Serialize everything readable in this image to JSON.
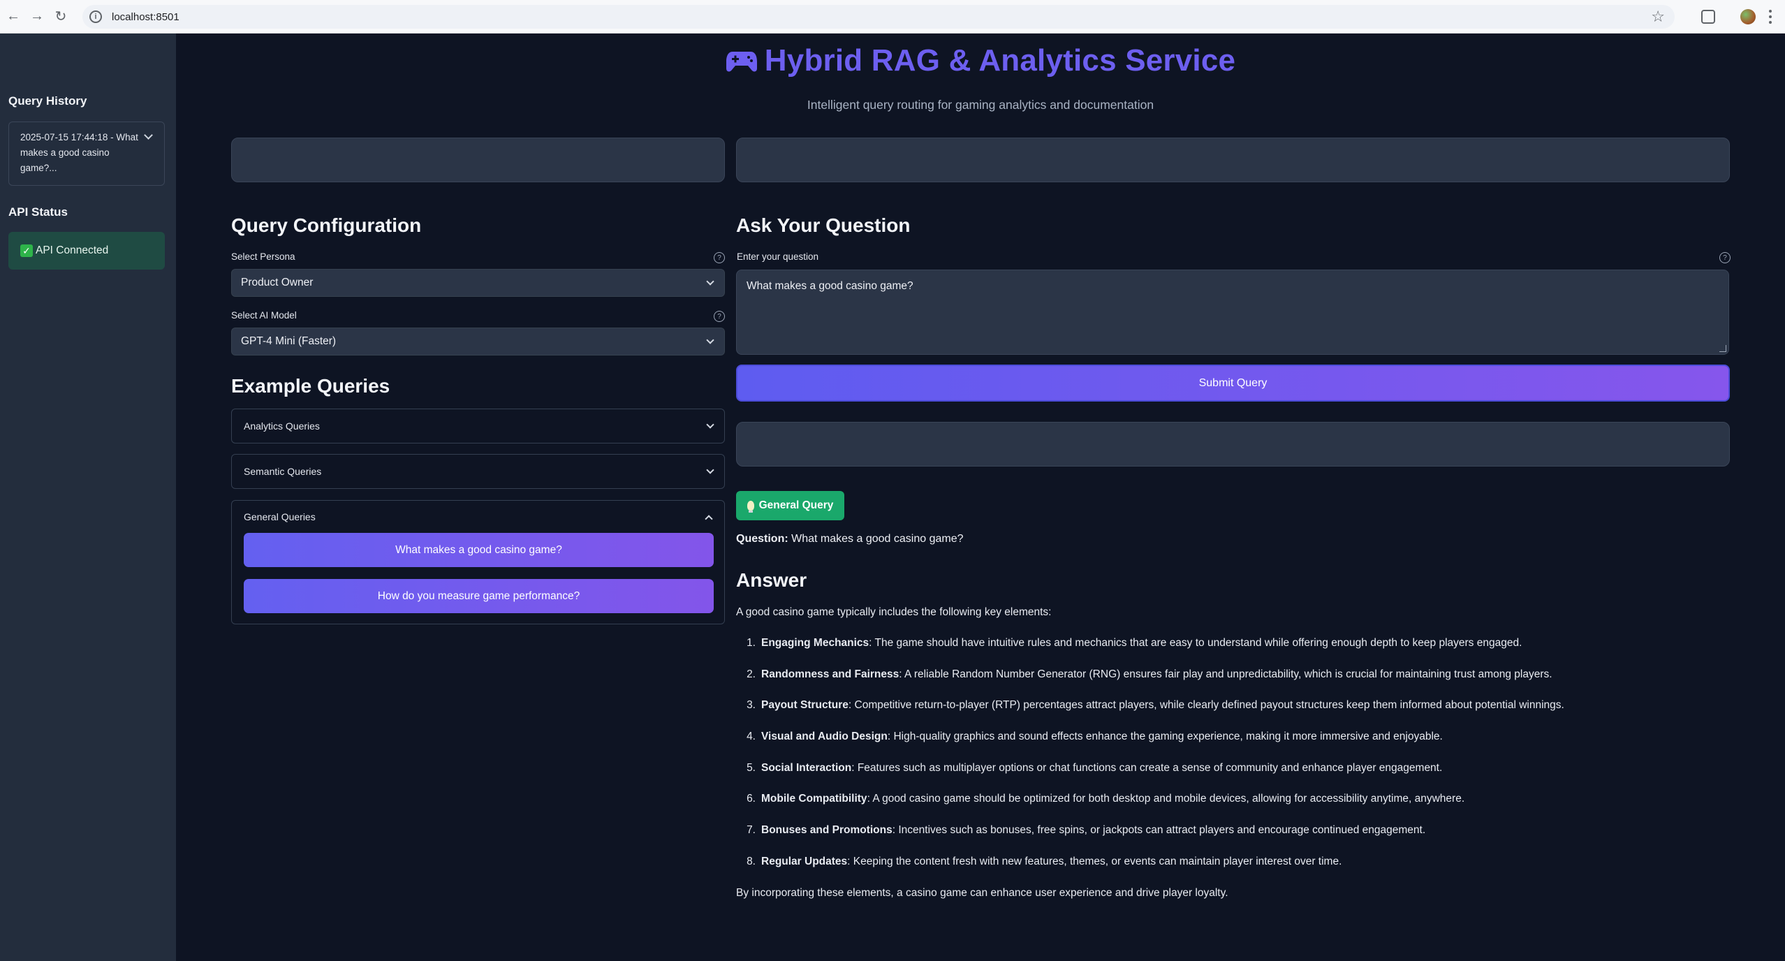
{
  "browser": {
    "url": "localhost:8501"
  },
  "sidebar": {
    "history_heading": "Query History",
    "history_item": "2025-07-15 17:44:18 - What makes a good casino game?...",
    "status_heading": "API Status",
    "status_text": "API Connected",
    "status_color": "#1f4b43"
  },
  "header": {
    "title": "Hybrid RAG & Analytics Service",
    "subtitle": "Intelligent query routing for gaming analytics and documentation",
    "title_color": "#6d5ff0"
  },
  "config": {
    "heading": "Query Configuration",
    "persona_label": "Select Persona",
    "persona_value": "Product Owner",
    "model_label": "Select AI Model",
    "model_value": "GPT-4 Mini (Faster)"
  },
  "examples": {
    "heading": "Example Queries",
    "groups": [
      {
        "label": "Analytics Queries"
      },
      {
        "label": "Semantic Queries"
      },
      {
        "label": "General Queries"
      }
    ],
    "general_buttons": [
      "What makes a good casino game?",
      "How do you measure game performance?"
    ]
  },
  "ask": {
    "heading": "Ask Your Question",
    "input_label": "Enter your question",
    "input_value": "What makes a good casino game?",
    "submit_label": "Submit Query"
  },
  "result": {
    "badge": "General Query",
    "badge_color": "#1aa86b",
    "question_prefix": "Question:",
    "question": "What makes a good casino game?",
    "answer_heading": "Answer",
    "intro": "A good casino game typically includes the following key elements:",
    "items": [
      {
        "num": "1.",
        "label": "Engaging Mechanics",
        "text": ": The game should have intuitive rules and mechanics that are easy to understand while offering enough depth to keep players engaged."
      },
      {
        "num": "2.",
        "label": "Randomness and Fairness",
        "text": ": A reliable Random Number Generator (RNG) ensures fair play and unpredictability, which is crucial for maintaining trust among players."
      },
      {
        "num": "3.",
        "label": "Payout Structure",
        "text": ": Competitive return-to-player (RTP) percentages attract players, while clearly defined payout structures keep them informed about potential winnings."
      },
      {
        "num": "4.",
        "label": "Visual and Audio Design",
        "text": ": High-quality graphics and sound effects enhance the gaming experience, making it more immersive and enjoyable."
      },
      {
        "num": "5.",
        "label": "Social Interaction",
        "text": ": Features such as multiplayer options or chat functions can create a sense of community and enhance player engagement."
      },
      {
        "num": "6.",
        "label": "Mobile Compatibility",
        "text": ": A good casino game should be optimized for both desktop and mobile devices, allowing for accessibility anytime, anywhere."
      },
      {
        "num": "7.",
        "label": "Bonuses and Promotions",
        "text": ": Incentives such as bonuses, free spins, or jackpots can attract players and encourage continued engagement."
      },
      {
        "num": "8.",
        "label": "Regular Updates",
        "text": ": Keeping the content fresh with new features, themes, or events can maintain player interest over time."
      }
    ],
    "outro": "By incorporating these elements, a casino game can enhance user experience and drive player loyalty."
  },
  "icons": [
    "back-icon",
    "forward-icon",
    "reload-icon",
    "site-info-icon",
    "bookmark-star-icon",
    "extensions-icon",
    "profile-avatar",
    "menu-icon",
    "chevron-down-icon",
    "gamepad-icon",
    "help-icon",
    "checkmark-icon",
    "lightbulb-icon"
  ]
}
